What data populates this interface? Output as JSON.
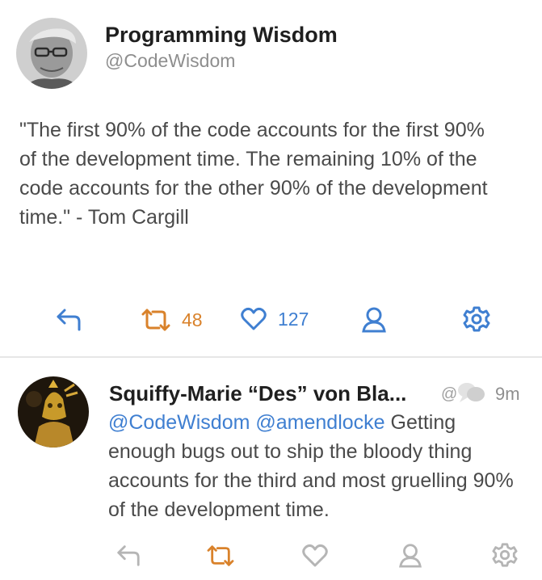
{
  "colors": {
    "mention": "#3f7fd1",
    "retweet_active": "#d9822b",
    "favourite_active": "#3f7fd1",
    "action_inactive": "#b5b5b5",
    "text": "#4a4a4a"
  },
  "tweet1": {
    "display_name": "Programming Wisdom",
    "handle": "@CodeWisdom",
    "text": "\"The first 90% of the code accounts for the first 90% of the development time. The remaining 10% of the code accounts for the other 90% of the development time.\" - Tom Cargill",
    "actions": {
      "reply_icon": "reply-icon",
      "retweet_icon": "retweet-icon",
      "retweet_count": "48",
      "favourite_icon": "heart-icon",
      "favourite_count": "127",
      "user_icon": "user-icon",
      "settings_icon": "gear-icon"
    }
  },
  "tweet2": {
    "display_name": "Squiffy-Marie “Des” von Bla...",
    "at_symbol": "@",
    "time": "9m",
    "mentions": [
      "@CodeWisdom",
      "@amendlocke"
    ],
    "text": "Getting enough bugs out to ship the bloody thing accounts for the third and most gruelling 90% of the development time.",
    "actions": {
      "reply_icon": "reply-icon",
      "retweet_icon": "retweet-icon",
      "favourite_icon": "heart-icon",
      "user_icon": "user-icon",
      "settings_icon": "gear-icon"
    }
  }
}
